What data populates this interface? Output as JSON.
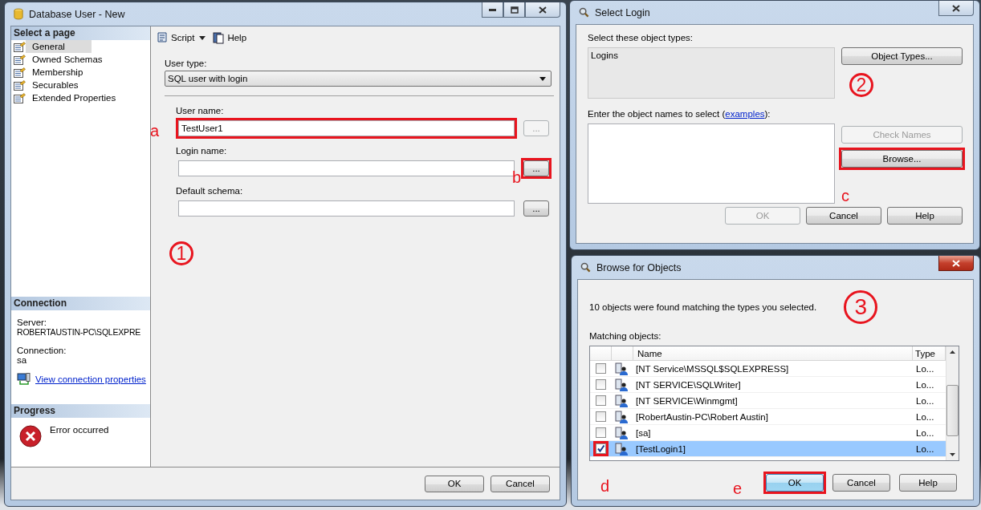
{
  "main_window": {
    "title": "Database User - New",
    "active": false,
    "select_page": {
      "heading": "Select a page",
      "items": [
        {
          "label": "General",
          "selected": true
        },
        {
          "label": "Owned Schemas",
          "selected": false
        },
        {
          "label": "Membership",
          "selected": false
        },
        {
          "label": "Securables",
          "selected": false
        },
        {
          "label": "Extended Properties",
          "selected": false
        }
      ]
    },
    "connection": {
      "heading": "Connection",
      "server_label": "Server:",
      "server": "ROBERTAUSTIN-PC\\SQLEXPRE",
      "connection_label": "Connection:",
      "connection": "sa",
      "link": "View connection properties"
    },
    "progress": {
      "heading": "Progress",
      "status": "Error occurred"
    },
    "toolbar": {
      "script": "Script",
      "help": "Help"
    },
    "user_type": {
      "label": "User type:",
      "value": "SQL user with login"
    },
    "fields": [
      {
        "label": "User name:",
        "value": "TestUser1",
        "highlighted": true,
        "annotation": "a",
        "button": "...",
        "button_disabled": true,
        "button_highlighted": false
      },
      {
        "label": "Login name:",
        "highlighted": false,
        "button": "...",
        "button_disabled": false,
        "button_highlighted": true,
        "annotation": "b"
      },
      {
        "label": "Default schema:",
        "highlighted": false,
        "button": "...",
        "button_disabled": false,
        "button_highlighted": false
      }
    ],
    "circled_note": "1",
    "buttons": [
      {
        "label": "OK",
        "disabled": false
      },
      {
        "label": "Cancel",
        "disabled": false
      }
    ]
  },
  "select_login": {
    "title": "Select Login",
    "active": false,
    "types_label": "Select these object types:",
    "types_value": "Logins",
    "object_types_button": "Object Types...",
    "circled_note": "2",
    "names_prompt": "Enter the object names to select (",
    "names_link": "examples",
    "names_prompt_end": "):",
    "check_names": {
      "label": "Check Names",
      "disabled": true,
      "highlighted": false
    },
    "browse": {
      "label": "Browse...",
      "disabled": false,
      "highlighted": true,
      "annotation": "c"
    },
    "buttons": [
      {
        "label": "OK",
        "disabled": true
      },
      {
        "label": "Cancel",
        "disabled": false
      },
      {
        "label": "Help",
        "disabled": false
      }
    ]
  },
  "browse_objects": {
    "title": "Browse for Objects",
    "active": true,
    "message": "10 objects were found matching the types you selected.",
    "circled_note": "3",
    "matching_label": "Matching objects:",
    "columns": [
      "Name",
      "Type"
    ],
    "rows": [
      {
        "name": "[NT Service\\MSSQL$SQLEXPRESS]",
        "type": "Lo...",
        "checked": false,
        "selected": false,
        "highlighted": false
      },
      {
        "name": "[NT SERVICE\\SQLWriter]",
        "type": "Lo...",
        "checked": false,
        "selected": false,
        "highlighted": false
      },
      {
        "name": "[NT SERVICE\\Winmgmt]",
        "type": "Lo...",
        "checked": false,
        "selected": false,
        "highlighted": false
      },
      {
        "name": "[RobertAustin-PC\\Robert Austin]",
        "type": "Lo...",
        "checked": false,
        "selected": false,
        "highlighted": false
      },
      {
        "name": "[sa]",
        "type": "Lo...",
        "checked": false,
        "selected": false,
        "highlighted": false
      },
      {
        "name": "[TestLogin1]",
        "type": "Lo...",
        "checked": true,
        "selected": true,
        "highlighted": true
      }
    ],
    "checkbox_annotation": "d",
    "buttons": [
      {
        "label": "OK",
        "default": true,
        "highlighted": true,
        "annotation": "e"
      },
      {
        "label": "Cancel",
        "default": false,
        "highlighted": false
      },
      {
        "label": "Help",
        "default": false,
        "highlighted": false
      }
    ]
  }
}
